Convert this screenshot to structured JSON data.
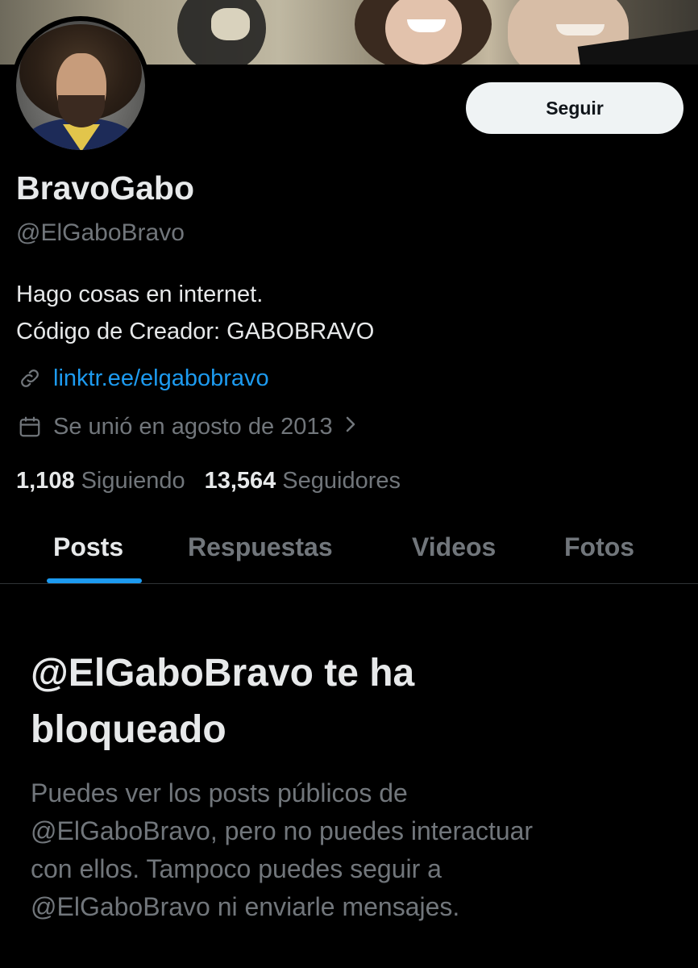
{
  "profile": {
    "display_name": "BravoGabo",
    "handle": "@ElGaboBravo",
    "bio_lines": [
      "Hago cosas en internet.",
      "Código de Creador: GABOBRAVO"
    ],
    "link": "linktr.ee/elgabobravo",
    "joined": "Se unió en agosto de 2013",
    "following_count": "1,108",
    "following_label": "Siguiendo",
    "followers_count": "13,564",
    "followers_label": "Seguidores"
  },
  "actions": {
    "follow_label": "Seguir"
  },
  "tabs": [
    {
      "label": "Posts",
      "active": true
    },
    {
      "label": "Respuestas",
      "active": false
    },
    {
      "label": "Videos",
      "active": false
    },
    {
      "label": "Fotos",
      "active": false
    }
  ],
  "blocked": {
    "title_lines": [
      "@ElGaboBravo te ha",
      "bloqueado"
    ],
    "desc_lines": [
      "Puedes ver los posts públicos de",
      "@ElGaboBravo, pero no puedes interactuar",
      "con ellos. Tampoco puedes seguir a",
      "@ElGaboBravo ni enviarle mensajes."
    ]
  },
  "icons": {
    "link": "link-icon",
    "calendar": "calendar-icon",
    "chevron": "chevron-right-icon"
  },
  "colors": {
    "background": "#000000",
    "accent": "#1d9bf0",
    "muted": "#71767b",
    "text": "#e7e9ea"
  }
}
